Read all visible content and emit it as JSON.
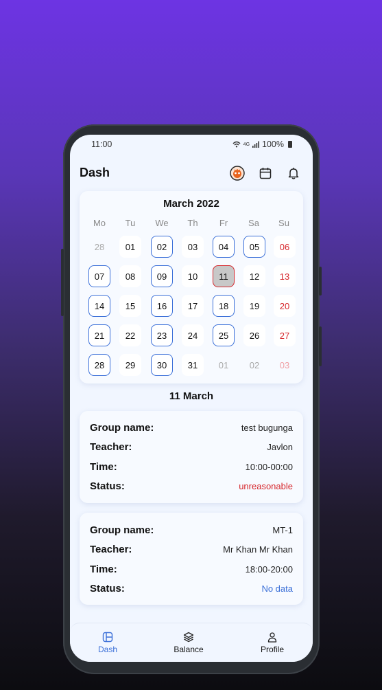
{
  "status_bar": {
    "time": "11:00",
    "network": "4G",
    "battery": "100%"
  },
  "header": {
    "title": "Dash"
  },
  "calendar": {
    "month_title": "March 2022",
    "weekdays": [
      "Mo",
      "Tu",
      "We",
      "Th",
      "Fr",
      "Sa",
      "Su"
    ],
    "weeks": [
      [
        "28",
        "01",
        "02",
        "03",
        "04",
        "05",
        "06"
      ],
      [
        "07",
        "08",
        "09",
        "10",
        "11",
        "12",
        "13"
      ],
      [
        "14",
        "15",
        "16",
        "17",
        "18",
        "19",
        "20"
      ],
      [
        "21",
        "22",
        "23",
        "24",
        "25",
        "26",
        "27"
      ],
      [
        "28",
        "29",
        "30",
        "31",
        "01",
        "02",
        "03"
      ]
    ]
  },
  "selected_date_label": "11 March",
  "lessons": [
    {
      "group_label": "Group name:",
      "group": "test bugunga",
      "teacher_label": "Teacher:",
      "teacher": "Javlon",
      "time_label": "Time:",
      "time": "10:00-00:00",
      "status_label": "Status:",
      "status": "unreasonable"
    },
    {
      "group_label": "Group name:",
      "group": "MT-1",
      "teacher_label": "Teacher:",
      "teacher": "Mr Khan Mr Khan",
      "time_label": "Time:",
      "time": "18:00-20:00",
      "status_label": "Status:",
      "status": "No data"
    }
  ],
  "nav": {
    "dash": "Dash",
    "balance": "Balance",
    "profile": "Profile"
  },
  "colors": {
    "accent": "#3a6fd8",
    "sunday": "#d6262b",
    "background_top": "#6d34e3"
  }
}
